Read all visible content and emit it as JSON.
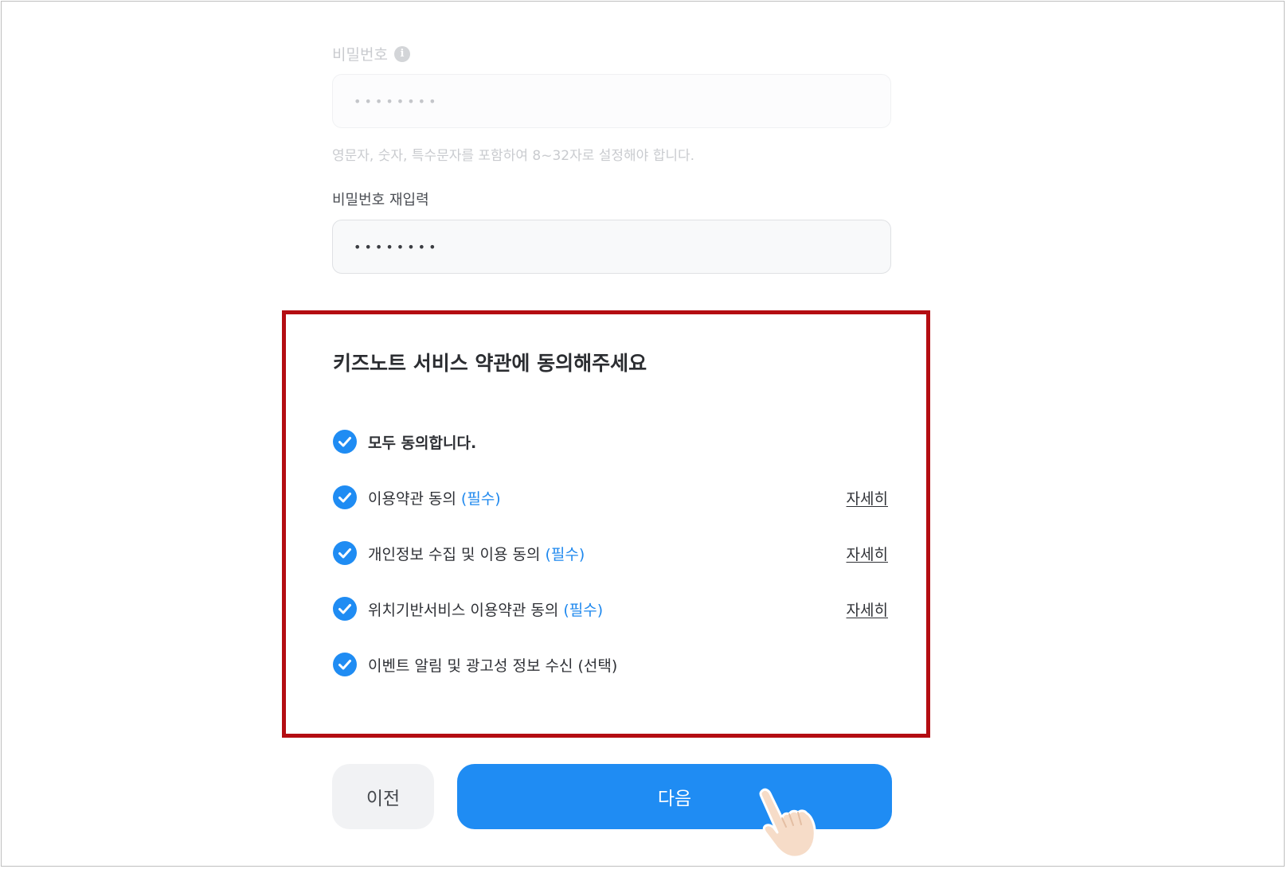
{
  "password": {
    "label": "비밀번호",
    "value_mask": "••••••••",
    "hint": "영문자, 숫자, 특수문자를 포함하여 8~32자로 설정해야 합니다."
  },
  "password_confirm": {
    "label": "비밀번호 재입력",
    "value_mask": "••••••••"
  },
  "terms": {
    "title": "키즈노트 서비스 약관에 동의해주세요",
    "all_agree": {
      "label": "모두 동의합니다.",
      "checked": true
    },
    "items": [
      {
        "label": "이용약관 동의",
        "tag": "(필수)",
        "detail": "자세히",
        "checked": true
      },
      {
        "label": "개인정보 수집 및 이용 동의",
        "tag": "(필수)",
        "detail": "자세히",
        "checked": true
      },
      {
        "label": "위치기반서비스 이용약관 동의",
        "tag": "(필수)",
        "detail": "자세히",
        "checked": true
      },
      {
        "label": "이벤트 알림 및 광고성 정보 수신 (선택)",
        "checked": true
      }
    ]
  },
  "buttons": {
    "prev": "이전",
    "next": "다음"
  },
  "colors": {
    "accent": "#1f8cf3",
    "highlight_border": "#b40d12",
    "check": "#1f8cf3"
  },
  "icons": {
    "info": "info-icon",
    "check": "check-circle-icon",
    "pointer": "hand-pointer-icon"
  }
}
